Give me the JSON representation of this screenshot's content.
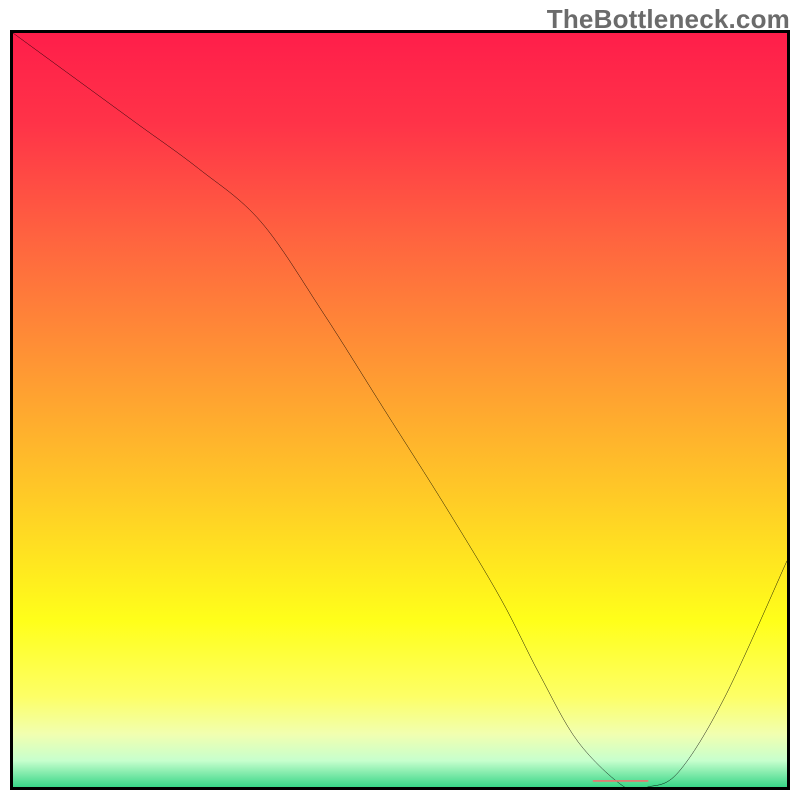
{
  "watermark": "TheBottleneck.com",
  "chart_data": {
    "type": "line",
    "title": "",
    "xlabel": "",
    "ylabel": "",
    "xlim": [
      0,
      100
    ],
    "ylim": [
      0,
      100
    ],
    "grid": false,
    "legend": false,
    "gradient_stops": [
      {
        "offset": 0.0,
        "color": "#ff1e4a"
      },
      {
        "offset": 0.12,
        "color": "#ff3348"
      },
      {
        "offset": 0.28,
        "color": "#ff663f"
      },
      {
        "offset": 0.45,
        "color": "#ff9933"
      },
      {
        "offset": 0.62,
        "color": "#ffcc26"
      },
      {
        "offset": 0.78,
        "color": "#ffff1a"
      },
      {
        "offset": 0.88,
        "color": "#fdff66"
      },
      {
        "offset": 0.93,
        "color": "#f1ffb0"
      },
      {
        "offset": 0.965,
        "color": "#c7ffcd"
      },
      {
        "offset": 1.0,
        "color": "#39d688"
      }
    ],
    "series": [
      {
        "name": "bottleneck-curve",
        "kind": "line",
        "color": "#000000",
        "x": [
          0,
          8,
          16,
          24,
          32,
          40,
          48,
          56,
          63,
          68,
          73,
          79,
          82,
          86,
          92,
          100
        ],
        "y": [
          100,
          94,
          88,
          82,
          75,
          63,
          50,
          37,
          25,
          15,
          6,
          0,
          0,
          2,
          12,
          30
        ]
      },
      {
        "name": "marker",
        "kind": "segment",
        "color": "#f06e6e",
        "x": [
          75,
          82
        ],
        "y": [
          0.8,
          0.8
        ],
        "thickness": 1.5
      }
    ]
  }
}
